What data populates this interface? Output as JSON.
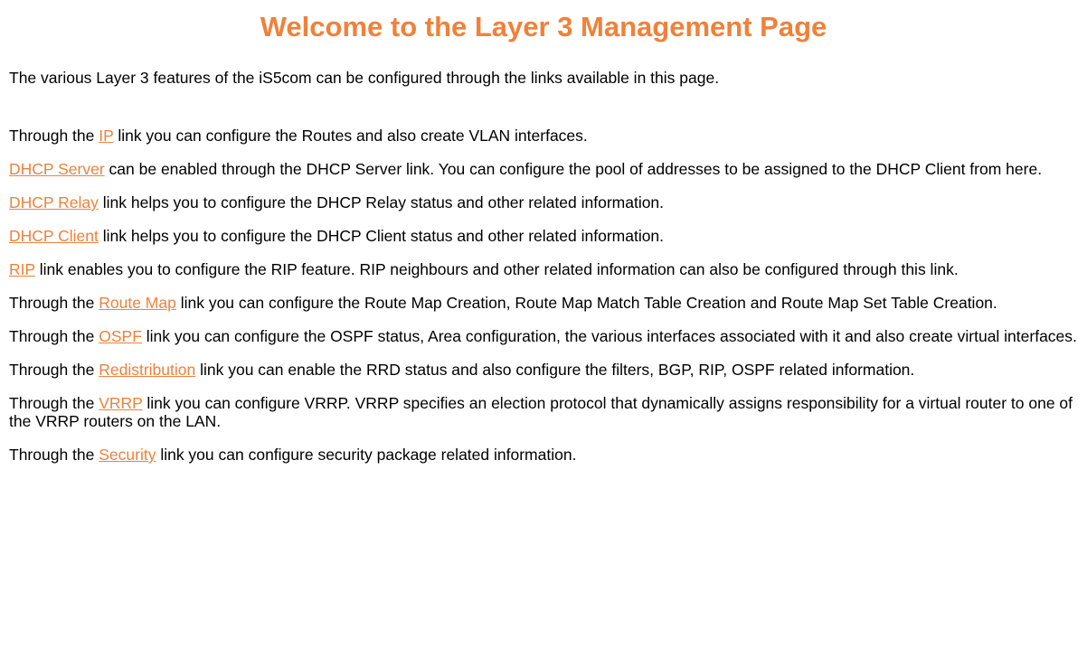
{
  "page": {
    "title": "Welcome to the Layer 3 Management Page",
    "intro": "The various Layer 3 features of the iS5com can be configured through the links available in this page.",
    "link_color": "#f0813a"
  },
  "items": [
    {
      "before": "Through the ",
      "link": "IP",
      "after": " link you can configure the Routes and also create VLAN interfaces."
    },
    {
      "before": "",
      "link": "DHCP Server",
      "after": " can be enabled through the DHCP Server link. You can configure the pool of addresses to be assigned to the DHCP Client from here."
    },
    {
      "before": "",
      "link": "DHCP Relay",
      "after": " link helps you to configure the DHCP Relay status and other related information."
    },
    {
      "before": "",
      "link": "DHCP Client",
      "after": " link helps you to configure the DHCP Client status and other related information."
    },
    {
      "before": "",
      "link": "RIP",
      "after": " link enables you to configure the RIP feature. RIP neighbours and other related information can also be configured through this link."
    },
    {
      "before": "Through the ",
      "link": "Route Map",
      "after": " link you can configure the Route Map Creation, Route Map Match Table Creation and Route Map Set Table Creation."
    },
    {
      "before": "Through the ",
      "link": "OSPF",
      "after": " link you can configure the OSPF status, Area configuration, the various interfaces associated with it and also create virtual interfaces."
    },
    {
      "before": "Through the ",
      "link": "Redistribution",
      "after": " link you can enable the RRD status and also configure the filters, BGP, RIP, OSPF related information."
    },
    {
      "before": "Through the ",
      "link": "VRRP",
      "after": " link you can configure VRRP. VRRP specifies an election protocol that dynamically assigns responsibility for a virtual router to one of the VRRP routers on the LAN."
    },
    {
      "before": "Through the ",
      "link": "Security",
      "after": " link you can configure security package related information."
    }
  ]
}
